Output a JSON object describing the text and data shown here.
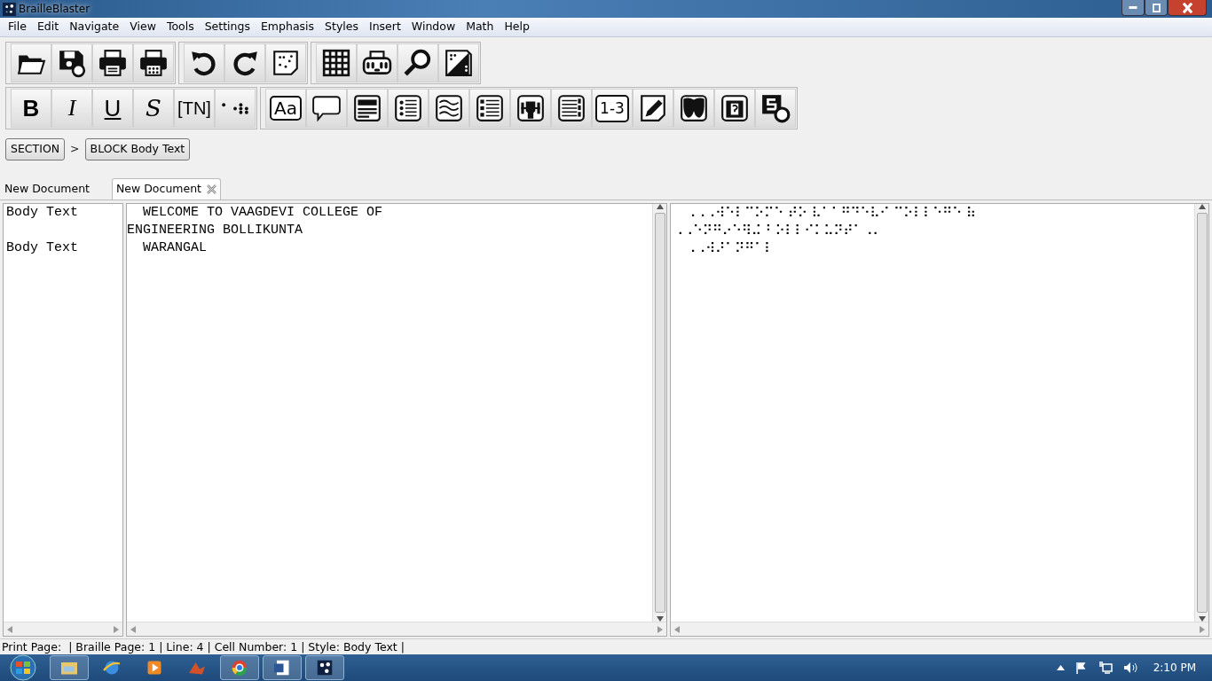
{
  "window": {
    "title": "BrailleBlaster"
  },
  "menu": [
    "File",
    "Edit",
    "Navigate",
    "View",
    "Tools",
    "Settings",
    "Emphasis",
    "Styles",
    "Insert",
    "Window",
    "Math",
    "Help"
  ],
  "toolbar_labels": [
    "B",
    "I",
    "U",
    "S",
    "[TN]",
    "Aa",
    "1-3"
  ],
  "breadcrumb": {
    "items": [
      "SECTION",
      "BLOCK Body Text"
    ],
    "separator": ">"
  },
  "tabs": [
    {
      "label": "New Document",
      "selected": false
    },
    {
      "label": "New Document",
      "selected": true
    }
  ],
  "paragraphs": [
    {
      "style": "Body Text",
      "lines": [
        "  WELCOME TO VAAGDEVI COLLEGE OF",
        "ENGINEERING BOLLIKUNTA"
      ]
    },
    {
      "style": "Body Text",
      "lines": [
        "  WARANGAL"
      ]
    }
  ],
  "braille_lines": [
    "   ⠠⠠⠠⠺⠑⠇⠉⠕⠍⠑ ⠞⠕ ⠧⠁⠁⠛⠙⠑⠧⠊ ⠉⠕⠇⠇⠑⠛⠑ ⠷",
    "⠠⠠⠑⠝⠛⠔⠑⠻⠬ ⠃⠕⠇⠇⠊⠅⠥⠝⠞⠁⠠⠄",
    "   ⠠⠠⠺⠜⠁⠝⠛⠁⠇"
  ],
  "status_bar": "Print Page:  | Braille Page: 1 | Line: 4 | Cell Number: 1 | Style: Body Text |",
  "taskbar": {
    "clock": "2:10 PM"
  }
}
